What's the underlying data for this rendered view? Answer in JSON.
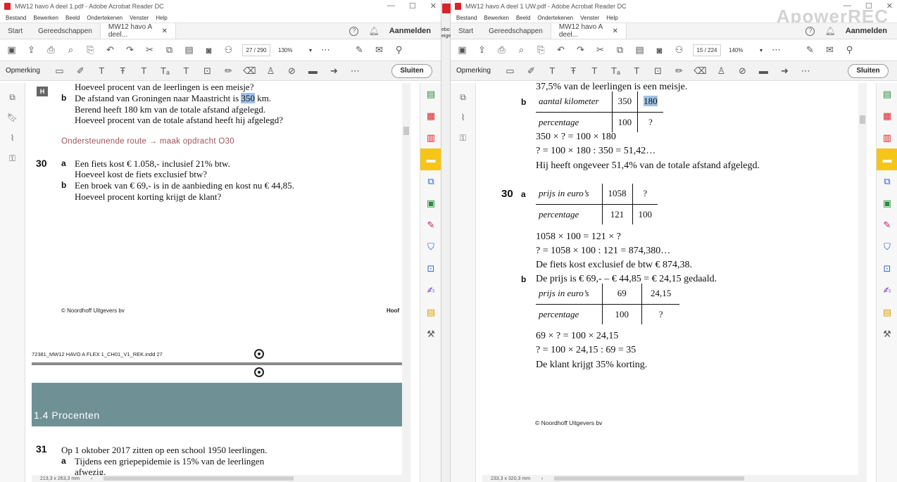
{
  "watermark": "ApowerREC",
  "left": {
    "title": "MW12 havo A deel 1.pdf - Adobe Acrobat Reader DC",
    "menu": [
      "Bestand",
      "Bewerken",
      "Beeld",
      "Ondertekenen",
      "Venster",
      "Help"
    ],
    "tabs": {
      "start": "Start",
      "tools": "Gereedschappen",
      "doc": "MW12 havo A deel...",
      "signin": "Aanmelden"
    },
    "page": {
      "current": "27",
      "total": "/ 290"
    },
    "zoom": "130%",
    "comment_label": "Opmerking",
    "close": "Sluiten",
    "status": "213,3 x 263,3 mm",
    "content": {
      "line_top": "Hoeveel procent van de leerlingen is een meisje?",
      "h_badge": "H",
      "b_letter": "b",
      "b_line1_pre": "De afstand van Groningen naar Maastricht is ",
      "b_line1_hl": "350",
      "b_line1_post": " km.",
      "b_line2": "Berend heeft 180 km van de totale afstand afgelegd.",
      "b_line3": "Hoeveel procent van de totale afstand heeft hij afgelegd?",
      "route": "Ondersteunende route → maak opdracht O30",
      "q30": "30",
      "q30a_letter": "a",
      "q30a_1": "Een fiets kost € 1.058,- inclusief 21% btw.",
      "q30a_2": "Hoeveel kost de fiets exclusief btw?",
      "q30b_letter": "b",
      "q30b_1": "Een broek van € 69,- is in de aanbieding en kost nu € 44,85.",
      "q30b_2": "Hoeveel procent korting krijgt de klant?",
      "footer_left": "© Noordhoff Uitgevers bv",
      "footer_right": "Hoof",
      "indd": "72381_MW12 HAVO A FLEX 1_CH01_V1_REK.indd   27",
      "section": "1.4   Procenten",
      "q31": "31",
      "q31_text": "Op 1 oktober 2017 zitten op een school 1950 leerlingen.",
      "q31a_letter": "a",
      "q31a_1": "Tijdens een griepepidemie is 15% van de leerlingen",
      "q31a_2": "afwezig."
    }
  },
  "right": {
    "title": "MW12 havo A deel 1 UW.pdf - Adobe Acrobat Reader DC",
    "menu": [
      "Bestand",
      "Bewerken",
      "Beeld",
      "Ondertekenen",
      "Venster",
      "Help"
    ],
    "tabs": {
      "start": "Start",
      "tools": "Gereedschappen",
      "doc": "MW12 havo A deel...",
      "signin": "Aanmelden"
    },
    "page": {
      "current": "15",
      "total": "/ 224"
    },
    "zoom": "140%",
    "comment_label": "Opmerking",
    "close": "Sluiten",
    "status": "233,3 x 320,3 mm",
    "content": {
      "line_top": "37,5% van de leerlingen is een meisje.",
      "b_letter": "b",
      "t1": {
        "r1": [
          "aantal kilometer",
          "350",
          "180"
        ],
        "r2": [
          "percentage",
          "100",
          "?"
        ]
      },
      "b_calc1": "350 × ? = 100 × 180",
      "b_calc2": "? = 100 × 180 : 350 = 51,42…",
      "b_concl": "Hij heeft ongeveer 51,4% van de totale afstand afgelegd.",
      "q30": "30",
      "a_letter": "a",
      "t2": {
        "r1": [
          "prijs in euro’s",
          "1058",
          "?"
        ],
        "r2": [
          "percentage",
          "121",
          "100"
        ]
      },
      "a_calc1": "1058 × 100 = 121 × ?",
      "a_calc2": "? = 1058 × 100 : 121 = 874,380…",
      "a_concl": "De fiets kost exclusief de btw € 874,38.",
      "b2_letter": "b",
      "b2_intro": "De prijs is € 69,- – € 44,85 = € 24,15 gedaald.",
      "t3": {
        "r1": [
          "prijs in euro’s",
          "69",
          "24,15"
        ],
        "r2": [
          "percentage",
          "100",
          "?"
        ]
      },
      "b2_calc1": "69 × ? = 100 × 24,15",
      "b2_calc2": "? = 100 × 24,15 : 69 = 35",
      "b2_concl": "De klant krijgt 35% korting.",
      "footer": "© Noordhoff Uitgevers bv"
    }
  },
  "divider_text": "ebo eige"
}
